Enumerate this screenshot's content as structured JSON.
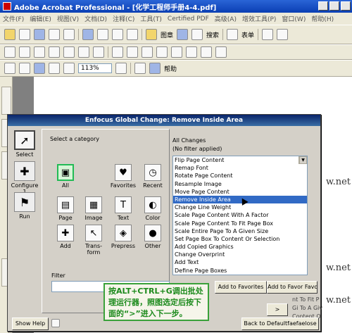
{
  "window": {
    "title": "Adobe Acrobat Professional - [化学工程师手册4-4.pdf]"
  },
  "menu": [
    "文件(F)",
    "编辑(E)",
    "视图(V)",
    "文档(D)",
    "注释(C)",
    "工具(T)",
    "Certified PDF",
    "高级(A)",
    "增效工具(P)",
    "窗口(W)",
    "帮助(H)"
  ],
  "toolbar": {
    "search_label": "搜索",
    "pdf_label": "图章",
    "forms_label": "表单",
    "zoom_value": "113%",
    "help_label": "帮助"
  },
  "doc": {
    "snippets": [
      "w.net",
      "w.net",
      "w.net"
    ]
  },
  "dialog": {
    "title": "Enfocus Global Change: Remove Inside Area",
    "leftbar": [
      {
        "label": "Select",
        "icon": "select-cursor-icon"
      },
      {
        "label": "Configure 1",
        "icon": "wrench-icon"
      },
      {
        "label": "Run",
        "icon": "flag-icon"
      }
    ],
    "category_label": "Select a category",
    "categories": [
      {
        "label": "All",
        "icon": "all-icon"
      },
      {
        "label": "Favorites",
        "icon": "favorites-icon"
      },
      {
        "label": "Recent",
        "icon": "clock-icon"
      },
      {
        "label": "Page",
        "icon": "page-icon"
      },
      {
        "label": "Image",
        "icon": "image-icon"
      },
      {
        "label": "Text",
        "icon": "text-icon"
      },
      {
        "label": "Color",
        "icon": "color-icon"
      },
      {
        "label": "Add",
        "icon": "add-icon"
      },
      {
        "label": "Trans-\nform",
        "icon": "transform-icon"
      },
      {
        "label": "Prepress",
        "icon": "prepress-icon"
      },
      {
        "label": "Other",
        "icon": "other-icon"
      }
    ],
    "filter_label": "Filter",
    "changes_title": "All Changes",
    "changes_subtitle": "(No filter applied)",
    "changes": [
      "Flip Page Content",
      "Remap Font",
      "Rotate Page Content",
      "Resample Image",
      "Move Page Content",
      "Remove Inside Area",
      "Change Line Weight",
      "Scale Page Content With A Factor",
      "Scale Page Content To Fit Page Box",
      "Scale Entire Page To A Given Size",
      "Set Page Box To Content Or Selection",
      "Add Copied Graphics",
      "Change Overprint",
      "Add Text",
      "Define Page Boxes"
    ],
    "selected_change": "Remove Inside Area",
    "buttons": {
      "add_to_favorites": "Add to Favorites",
      "add_to_favor_right": "Add to Favor Favo",
      "show_help": "Show Help",
      "next": ">",
      "back_to_default": "Back to Defaultfaefaelose"
    },
    "right_stub_lines": [
      "nt To Fit P",
      "Gi To A Giv",
      "Content O"
    ],
    "annotation": "按ALT+CTRL+G调出批处理运行器，照图选定后按下面的“>”进入下一步。"
  }
}
